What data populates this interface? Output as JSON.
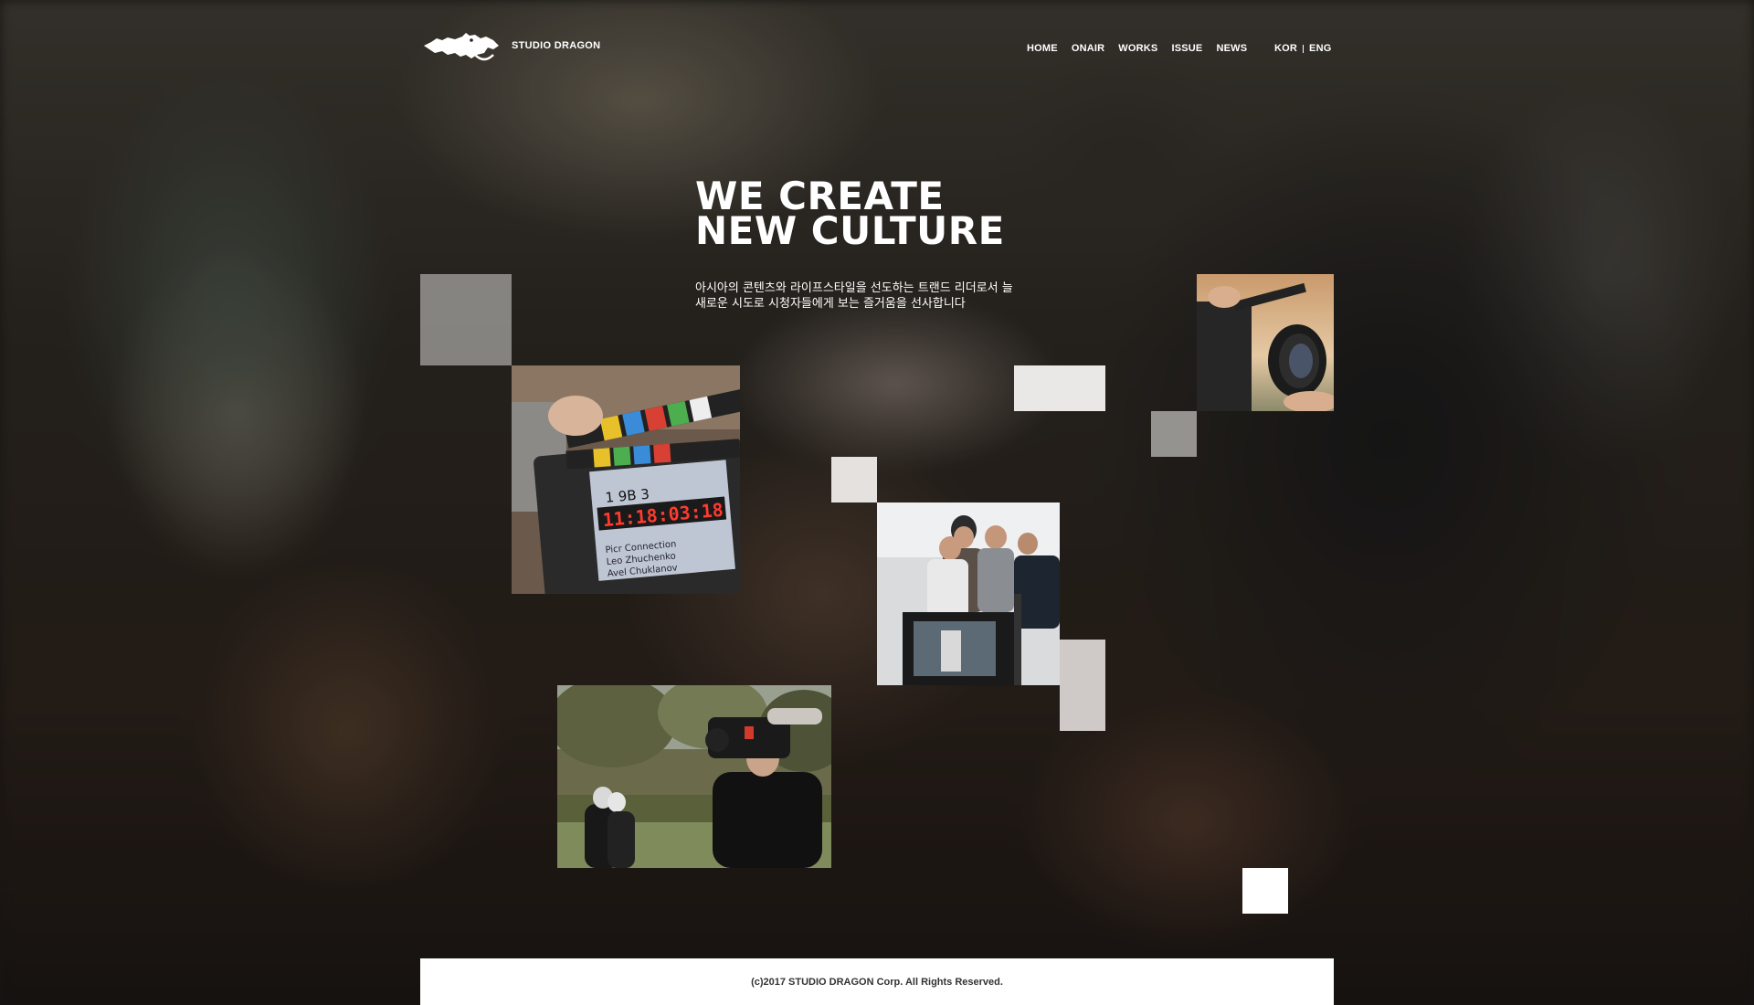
{
  "header": {
    "logo_text": "STUDIO DRAGON",
    "nav": [
      "HOME",
      "ONAIR",
      "WORKS",
      "ISSUE",
      "NEWS"
    ],
    "languages": [
      "KOR",
      "ENG"
    ]
  },
  "hero": {
    "headline_line1": "WE CREATE",
    "headline_line2": "NEW CULTURE",
    "subcopy_line1": "아시아의 콘텐츠와 라이프스타일을 선도하는 트랜드 리더로서 늘",
    "subcopy_line2": "새로운 시도로 시청자들에게 보는 즐거움을 선사합니다"
  },
  "footer": {
    "copyright": "(c)2017 STUDIO DRAGON Corp. All Rights Reserved."
  },
  "colors": {
    "accent_white": "#ffffff",
    "grey_square": "#8a8987",
    "light_square": "#e8e6e4"
  },
  "icons": [
    "dragon-logo-icon"
  ]
}
